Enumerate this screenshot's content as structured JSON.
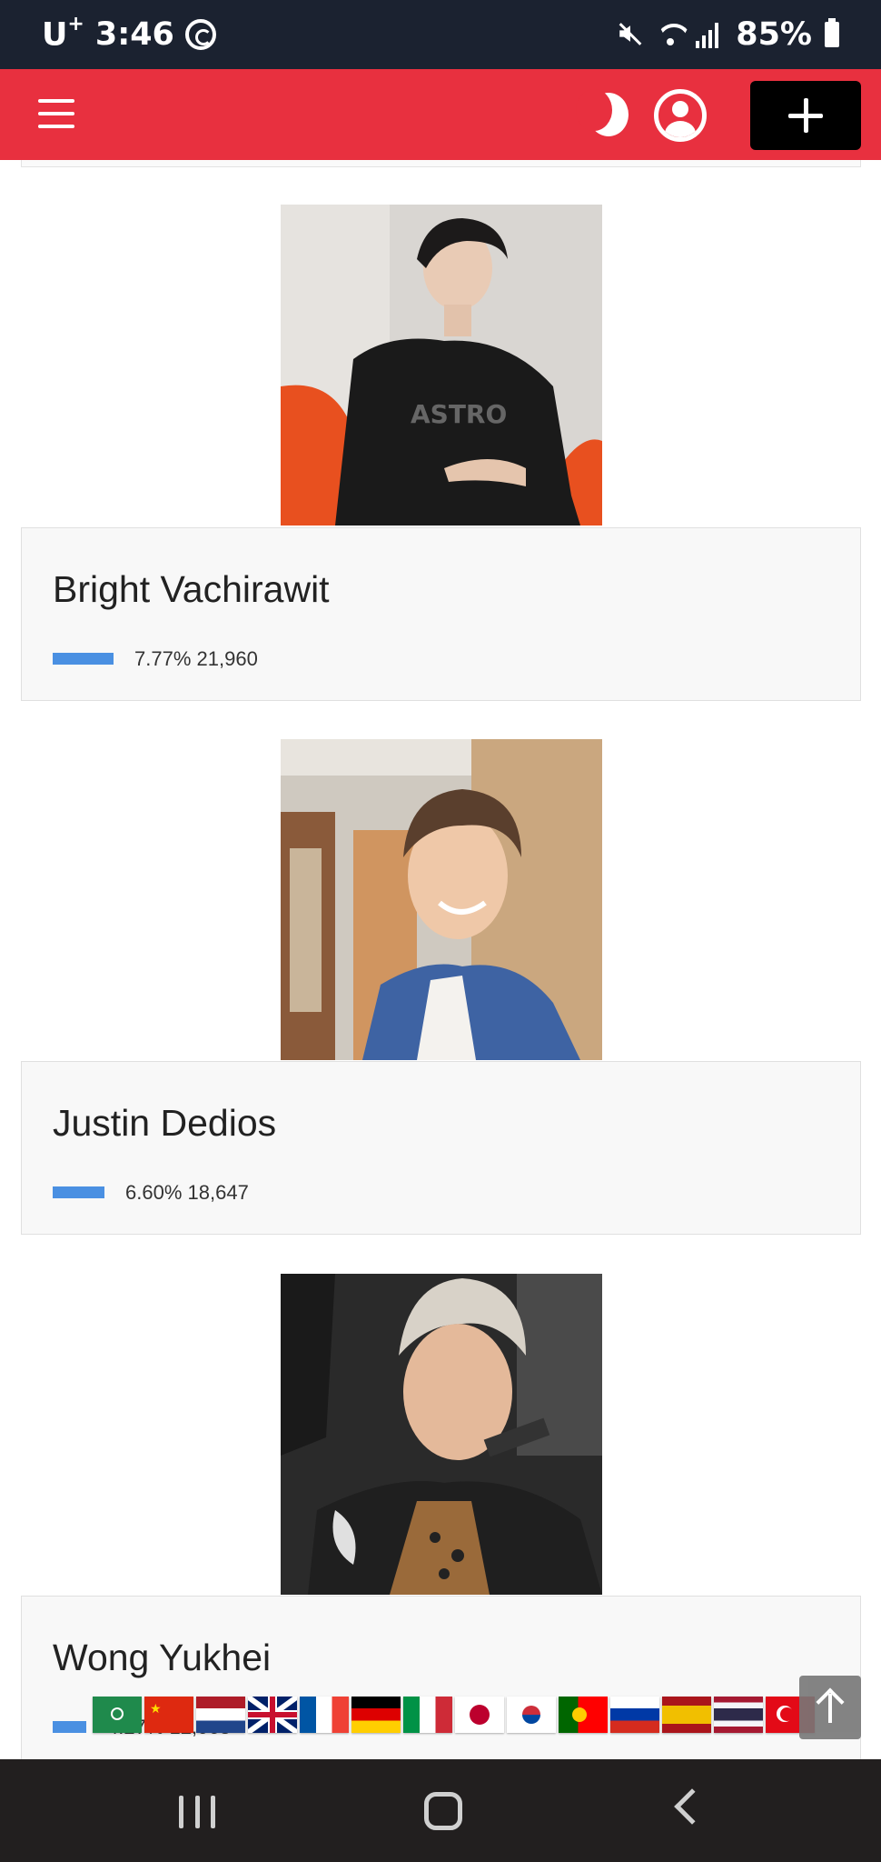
{
  "status_bar": {
    "carrier": "U",
    "carrier_sup": "+",
    "time": "3:46",
    "battery": "85%",
    "icons": [
      "sync-icon",
      "mute-icon",
      "wifi-icon",
      "signal-icon",
      "battery-icon"
    ]
  },
  "header": {
    "background": "#e8303f",
    "menu_icon": "hamburger-icon",
    "theme_icon": "moon-icon",
    "account_icon": "user-circle-icon",
    "add_icon": "plus-icon"
  },
  "candidates": [
    {
      "name": "Bright Vachirawit",
      "percent": "7.77%",
      "votes": "21,960",
      "percent_value": 7.77
    },
    {
      "name": "Justin Dedios",
      "percent": "6.60%",
      "votes": "18,647",
      "percent_value": 6.6
    },
    {
      "name": "Wong Yukhei",
      "percent": "4.27%",
      "votes": "12,068",
      "percent_value": 4.27
    }
  ],
  "bar_color": "#4a90e2",
  "languages": [
    "Arabic",
    "Chinese",
    "Dutch",
    "English",
    "French",
    "German",
    "Italian",
    "Japanese",
    "Korean",
    "Portuguese",
    "Russian",
    "Spanish",
    "Thai",
    "Turkish"
  ],
  "scroll_top_icon": "arrow-up-icon",
  "nav_bar": {
    "icons": [
      "recent-apps-icon",
      "home-icon",
      "back-icon"
    ]
  }
}
